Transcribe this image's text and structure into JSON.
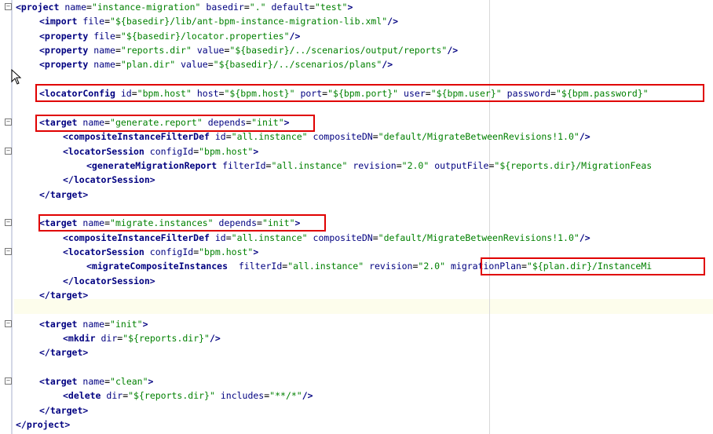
{
  "editor": {
    "colors": {
      "tag": "#000080",
      "attribute": "#000080",
      "value": "#008000",
      "highlight_box": "#e00000",
      "current_line": "#fdfdec"
    },
    "lines": [
      {
        "id": "l1",
        "indent": 0,
        "text": "<project name=\"instance-migration\" basedir=\".\" default=\"test\">",
        "fold": "minus"
      },
      {
        "id": "l2",
        "indent": 1,
        "text": "<import file=\"${basedir}/lib/ant-bpm-instance-migration-lib.xml\"/>"
      },
      {
        "id": "l3",
        "indent": 1,
        "text": "<property file=\"${basedir}/locator.properties\"/>"
      },
      {
        "id": "l4",
        "indent": 1,
        "text": "<property name=\"reports.dir\" value=\"${basedir}/../scenarios/output/reports\"/>"
      },
      {
        "id": "l5",
        "indent": 1,
        "text": "<property name=\"plan.dir\" value=\"${basedir}/../scenarios/plans\"/>"
      },
      {
        "id": "l6",
        "indent": 0,
        "text": ""
      },
      {
        "id": "l7",
        "indent": 1,
        "text": "<locatorConfig id=\"bpm.host\" host=\"${bpm.host}\" port=\"${bpm.port}\" user=\"${bpm.user}\" password=\"${bpm.password}\""
      },
      {
        "id": "l8",
        "indent": 0,
        "text": ""
      },
      {
        "id": "l9",
        "indent": 1,
        "text": "<target name=\"generate.report\" depends=\"init\">",
        "fold": "minus"
      },
      {
        "id": "l10",
        "indent": 2,
        "text": "<compositeInstanceFilterDef id=\"all.instance\" compositeDN=\"default/MigrateBetweenRevisions!1.0\"/>"
      },
      {
        "id": "l11",
        "indent": 2,
        "text": "<locatorSession configId=\"bpm.host\">",
        "fold": "minus"
      },
      {
        "id": "l12",
        "indent": 3,
        "text": "<generateMigrationReport filterId=\"all.instance\" revision=\"2.0\" outputFile=\"${reports.dir}/MigrationFeas"
      },
      {
        "id": "l13",
        "indent": 2,
        "text": "</locatorSession>"
      },
      {
        "id": "l14",
        "indent": 1,
        "text": "</target>"
      },
      {
        "id": "l15",
        "indent": 0,
        "text": ""
      },
      {
        "id": "l16",
        "indent": 1,
        "text": "<target name=\"migrate.instances\" depends=\"init\">",
        "fold": "minus"
      },
      {
        "id": "l17",
        "indent": 2,
        "text": "<compositeInstanceFilterDef id=\"all.instance\" compositeDN=\"default/MigrateBetweenRevisions!1.0\"/>"
      },
      {
        "id": "l18",
        "indent": 2,
        "text": "<locatorSession configId=\"bpm.host\">",
        "fold": "minus"
      },
      {
        "id": "l19",
        "indent": 3,
        "text": "<migrateCompositeInstances  filterId=\"all.instance\" revision=\"2.0\" migrationPlan=\"${plan.dir}/InstanceMi"
      },
      {
        "id": "l20",
        "indent": 2,
        "text": "</locatorSession>"
      },
      {
        "id": "l21",
        "indent": 1,
        "text": "</target>"
      },
      {
        "id": "l22",
        "indent": 0,
        "text": ""
      },
      {
        "id": "l23",
        "indent": 1,
        "text": "<target name=\"init\">",
        "fold": "minus"
      },
      {
        "id": "l24",
        "indent": 2,
        "text": "<mkdir dir=\"${reports.dir}\"/>"
      },
      {
        "id": "l25",
        "indent": 1,
        "text": "</target>"
      },
      {
        "id": "l26",
        "indent": 0,
        "text": ""
      },
      {
        "id": "l27",
        "indent": 1,
        "text": "<target name=\"clean\">",
        "fold": "minus"
      },
      {
        "id": "l28",
        "indent": 2,
        "text": "<delete dir=\"${reports.dir}\" includes=\"**/*\"/>"
      },
      {
        "id": "l29",
        "indent": 1,
        "text": "</target>"
      },
      {
        "id": "l30",
        "indent": 0,
        "text": "</project>"
      }
    ]
  }
}
